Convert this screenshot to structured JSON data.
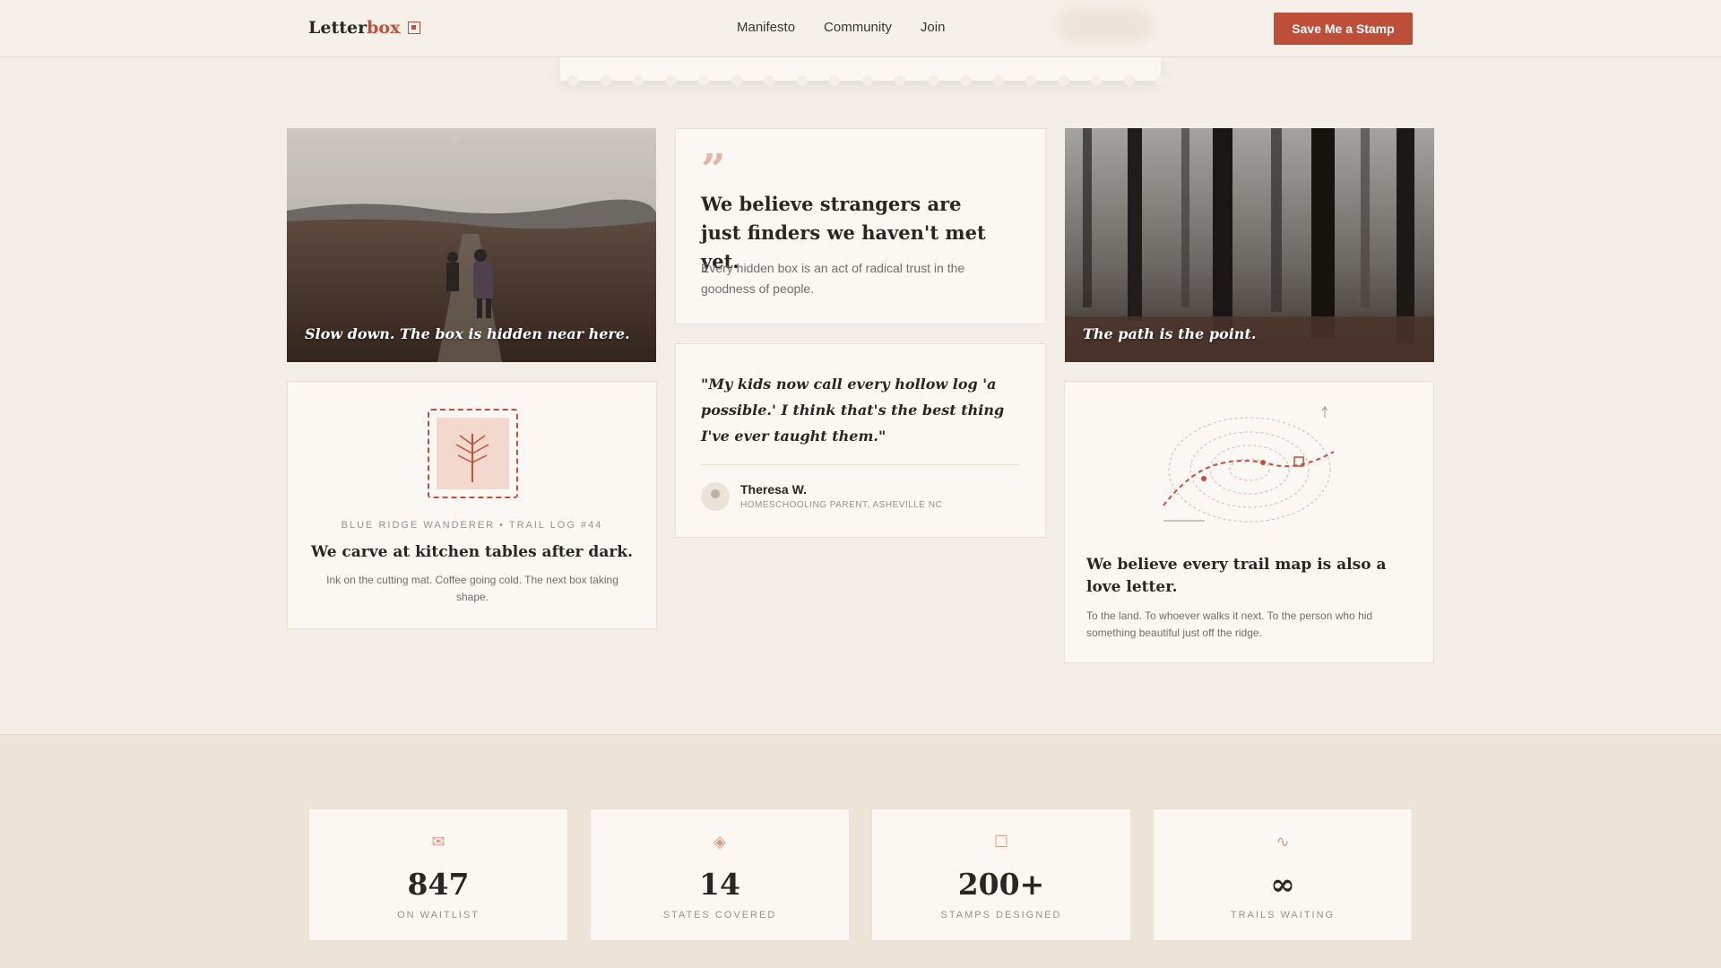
{
  "header": {
    "logo_main": "Letter",
    "logo_accent": "box",
    "nav": [
      "Manifesto",
      "Community",
      "Join"
    ],
    "cta_label": "Save Me a Stamp"
  },
  "cards": {
    "photo_left": {
      "caption": "Slow down. The box is hidden near here."
    },
    "manifesto_quote": {
      "mark": "”",
      "title": "We believe strangers are just finders we haven't met yet.",
      "body": "Every hidden box is an act of radical trust in the goodness of people."
    },
    "photo_right": {
      "caption": "The path is the point."
    },
    "stamp_card": {
      "eyebrow": "BLUE RIDGE WANDERER • TRAIL LOG #44",
      "title": "We carve at kitchen tables after dark.",
      "body": "Ink on the cutting mat. Coffee going cold. The next box taking shape."
    },
    "testimonial": {
      "quote": "\"My kids now call every hollow log 'a possible.' I think that's the best thing I've ever taught them.\"",
      "name": "Theresa W.",
      "role": "HOMESCHOOLING PARENT, ASHEVILLE NC"
    },
    "map_card": {
      "title": "We believe every trail map is also a love letter.",
      "body": "To the land. To whoever walks it next. To the person who hid something beautiful just off the ridge."
    }
  },
  "stats": [
    {
      "icon": "envelope-icon",
      "glyph": "✉",
      "value": "847",
      "label": "ON WAITLIST"
    },
    {
      "icon": "diamond-icon",
      "glyph": "◈",
      "value": "14",
      "label": "STATES COVERED"
    },
    {
      "icon": "square-icon",
      "glyph": "☐",
      "value": "200+",
      "label": "STAMPS DESIGNED"
    },
    {
      "icon": "wave-icon",
      "glyph": "∿",
      "value": "∞",
      "label": "TRAILS WAITING"
    }
  ],
  "colors": {
    "accent": "#bd4f38",
    "background": "#f3eee7",
    "card": "#fbf8f3",
    "band": "#ede5d8"
  }
}
